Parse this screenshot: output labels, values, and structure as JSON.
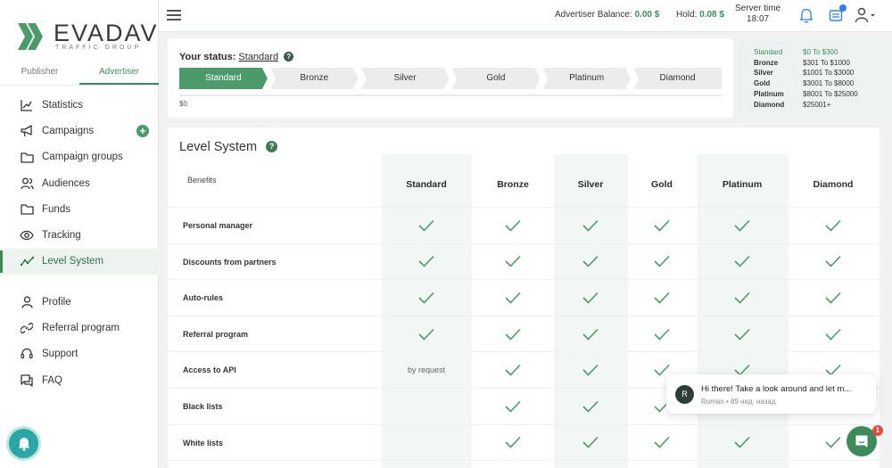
{
  "brand": {
    "name": "EVADAV",
    "subtitle": "TRAFFIC GROUP",
    "color": "#3f8a5c"
  },
  "sidebar": {
    "tabs": [
      {
        "label": "Publisher",
        "active": false
      },
      {
        "label": "Advertiser",
        "active": true
      }
    ],
    "items": [
      {
        "label": "Statistics",
        "icon": "chart-line-icon"
      },
      {
        "label": "Campaigns",
        "icon": "megaphone-icon"
      },
      {
        "label": "Campaign groups",
        "icon": "folder-icon"
      },
      {
        "label": "Audiences",
        "icon": "users-icon"
      },
      {
        "label": "Funds",
        "icon": "folder-icon"
      },
      {
        "label": "Tracking",
        "icon": "eye-icon"
      },
      {
        "label": "Level System",
        "icon": "trend-icon",
        "active": true
      },
      {
        "label": "Profile",
        "icon": "user-icon"
      },
      {
        "label": "Referral program",
        "icon": "link-icon"
      },
      {
        "label": "Support",
        "icon": "headset-icon"
      },
      {
        "label": "FAQ",
        "icon": "chat-icon"
      }
    ]
  },
  "header": {
    "balance_label": "Advertiser Balance:",
    "balance_value": "0.00 $",
    "hold_label": "Hold:",
    "hold_value": "0.08 $",
    "server_time_label": "Server time",
    "server_time_value": "18:07"
  },
  "status": {
    "label": "Your status:",
    "current": "Standard",
    "levels": [
      "Standard",
      "Bronze",
      "Silver",
      "Gold",
      "Platinum",
      "Diamond"
    ],
    "progress_start": "$0",
    "ranges": [
      {
        "name": "Standard",
        "range": "$0 To $300"
      },
      {
        "name": "Bronze",
        "range": "$301 To $1000"
      },
      {
        "name": "Silver",
        "range": "$1001 To $3000"
      },
      {
        "name": "Gold",
        "range": "$3001 To $8000"
      },
      {
        "name": "Platinum",
        "range": "$8001 To $25000"
      },
      {
        "name": "Diamond",
        "range": "$25001+"
      }
    ]
  },
  "level_system": {
    "title": "Level System",
    "benefits_header": "Benefits",
    "columns": [
      "Standard",
      "Bronze",
      "Silver",
      "Gold",
      "Platinum",
      "Diamond"
    ],
    "rows": [
      {
        "label": "Personal manager",
        "cells": [
          "check",
          "check",
          "check",
          "check",
          "check",
          "check"
        ]
      },
      {
        "label": "Discounts from partners",
        "cells": [
          "check",
          "check",
          "check",
          "check",
          "check",
          "check"
        ]
      },
      {
        "label": "Auto-rules",
        "cells": [
          "check",
          "check",
          "check",
          "check",
          "check",
          "check"
        ]
      },
      {
        "label": "Referral program",
        "cells": [
          "check",
          "check",
          "check",
          "check",
          "check",
          "check"
        ]
      },
      {
        "label": "Access to API",
        "cells": [
          "by request",
          "check",
          "check",
          "check",
          "check",
          "check"
        ]
      },
      {
        "label": "Black lists",
        "cells": [
          "",
          "check",
          "check",
          "check",
          "check",
          "check"
        ]
      },
      {
        "label": "White lists",
        "cells": [
          "",
          "check",
          "check",
          "check",
          "check",
          "check"
        ]
      }
    ]
  },
  "chat": {
    "avatar_letter": "R",
    "message": "Hi there! Take a look around and let m...",
    "meta": "Roman • 89 нед. назад",
    "unread": "1"
  }
}
